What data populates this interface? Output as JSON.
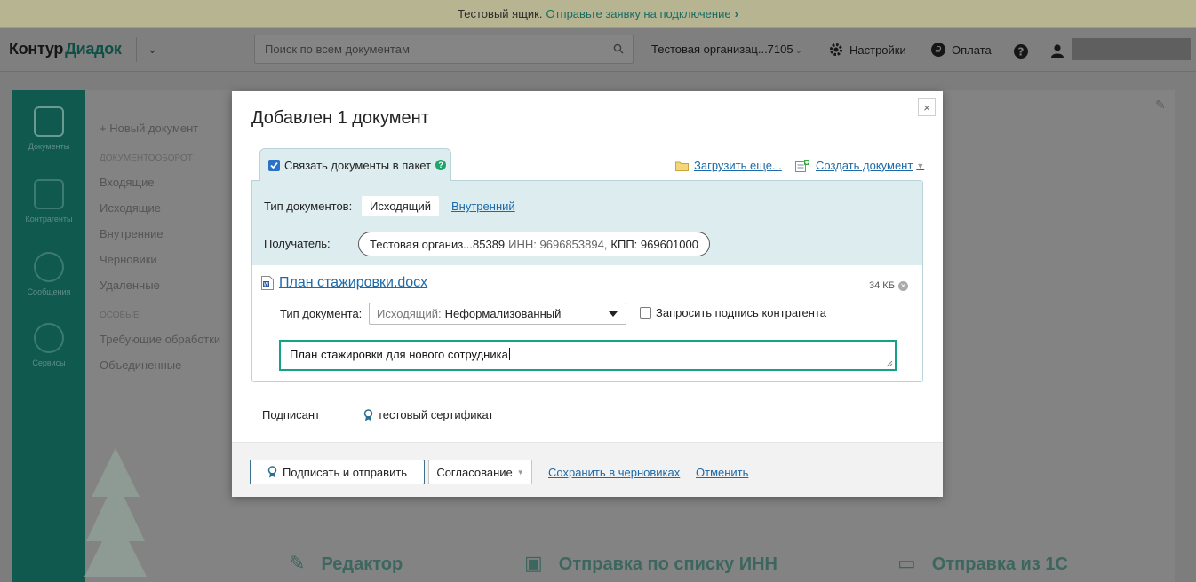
{
  "banner": {
    "text": "Тестовый ящик.",
    "link": "Отправьте заявку на подключение"
  },
  "header": {
    "logo_part1": "Контур",
    "logo_part2": "Диадок",
    "search_placeholder": "Поиск по всем документам",
    "org": "Тестовая организац...7105",
    "settings": "Настройки",
    "payment": "Оплата"
  },
  "background": {
    "nav": [
      "Документы",
      "Контрагенты",
      "Сообщения",
      "Сервисы"
    ],
    "sidebar": {
      "new_doc": "+ Новый документ",
      "docs_caption": "ДОКУМЕНТООБОРОТ",
      "docs": [
        "Входящие",
        "Исходящие",
        "Внутренние",
        "Черновики",
        "Удаленные"
      ],
      "extra_caption": "ОСОБЫЕ",
      "extra": [
        "Требующие обработки",
        "Объединенные"
      ]
    },
    "tiles": [
      "Редактор",
      "Отправка по списку ИНН",
      "Отправка из 1С"
    ]
  },
  "modal": {
    "title": "Добавлен 1 документ",
    "close": "×",
    "tab_label": "Связать документы в пакет",
    "upload_more": "Загрузить еще...",
    "create_doc": "Создать документ",
    "doc_types_label": "Тип документов:",
    "doc_type_active": "Исходящий",
    "doc_type_other": "Внутренний",
    "recipient_label": "Получатель:",
    "recipient_name": "Тестовая организ...85389",
    "recipient_inn": "ИНН: 9696853894,",
    "recipient_kpp": "КПП: 969601000",
    "file_name": "План стажировки.docx",
    "file_size": "34 КБ",
    "doc_type_field_label": "Тип документа:",
    "doc_type_select_prefix": "Исходящий:",
    "doc_type_select_value": "Неформализованный",
    "request_signature": "Запросить подпись контрагента",
    "comment": "План стажировки для нового сотрудника",
    "signer_label": "Подписант",
    "signer_value": "тестовый сертификат",
    "btn_sign_send": "Подписать и отправить",
    "btn_approval": "Согласование",
    "link_save_drafts": "Сохранить в черновиках",
    "link_cancel": "Отменить"
  },
  "colors": {
    "accent_green": "#16a085",
    "link_blue": "#1c6aa9",
    "panel_blue": "#dcecef",
    "nav_dark_green": "#10594f"
  }
}
